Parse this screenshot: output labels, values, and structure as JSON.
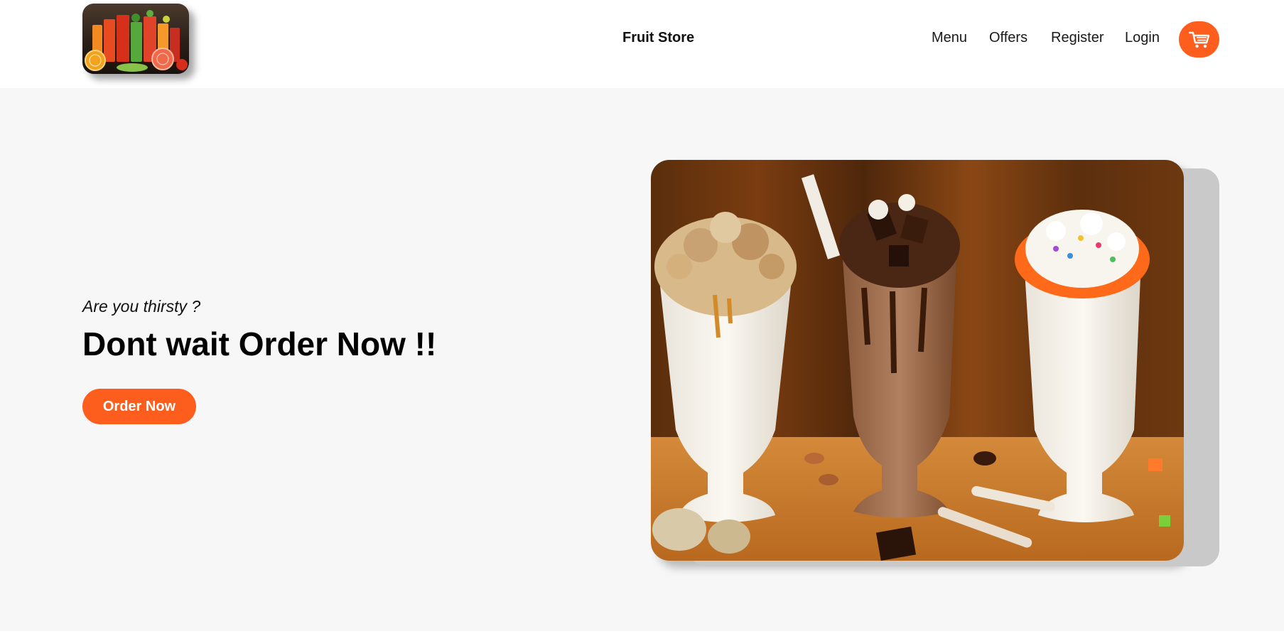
{
  "header": {
    "logo_alt": "Fresh juices logo",
    "brand": "Fruit Store",
    "nav": [
      "Menu",
      "Offers",
      "Register",
      "Login"
    ],
    "cart_icon": "shopping-cart-icon"
  },
  "hero": {
    "subtitle": "Are you thirsty ?",
    "headline": "Dont wait Order Now !!",
    "cta_label": "Order Now",
    "image_alt": "Three milkshakes on a wooden table"
  },
  "colors": {
    "accent": "#fd5d1d",
    "hero_bg": "#f7f7f7",
    "header_bg": "#ffffff",
    "text": "#111111"
  }
}
